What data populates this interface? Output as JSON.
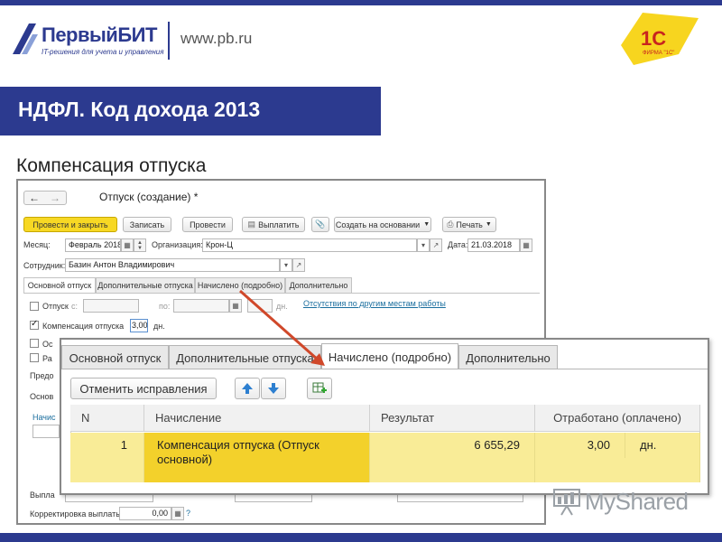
{
  "header": {
    "brand": "ПервыйБИТ",
    "tagline": "IT-решения для учета и управления",
    "website": "www.pb.ru",
    "badge_text": "1С",
    "badge_sub": "ФИРМА \"1С\""
  },
  "slide": {
    "title": "НДФЛ. Код дохода 2013",
    "subtitle": "Компенсация отпуска"
  },
  "window": {
    "title": "Отпуск (создание) *",
    "toolbar": {
      "post_close": "Провести и закрыть",
      "save": "Записать",
      "post": "Провести",
      "pay": "Выплатить",
      "create_base": "Создать на основании",
      "print": "Печать"
    },
    "fields": {
      "month_label": "Месяц:",
      "month_value": "Февраль 2018",
      "org_label": "Организация:",
      "org_value": "Крон-Ц",
      "date_label": "Дата:",
      "date_value": "21.03.2018",
      "employee_label": "Сотрудник:",
      "employee_value": "Базин Антон Владимирович"
    },
    "tabs": [
      "Основной отпуск",
      "Дополнительные отпуска",
      "Начислено (подробно)",
      "Дополнительно"
    ],
    "main": {
      "vacation_label": "Отпуск",
      "from_label": "с:",
      "to_label": "по:",
      "days_suffix": "дн.",
      "absence_link": "Отсутствия по другим местам работы",
      "comp_label": "Компенсация отпуска",
      "comp_value": "3,00",
      "comp_suffix": "дн.",
      "trunc1": "Ос",
      "trunc2": "Ра",
      "trunc3": "Предо",
      "trunc4": "Основ",
      "trunc5": "Начис",
      "trunc6": "Выпла",
      "correction_label": "Корректировка выплаты:",
      "correction_value": "0,00"
    }
  },
  "zoom": {
    "tabs": [
      "Основной отпуск",
      "Дополнительные отпуска",
      "Начислено (подробно)",
      "Дополнительно"
    ],
    "cancel_button": "Отменить исправления",
    "columns": [
      "N",
      "Начисление",
      "Результат",
      "Отработано (оплачено)"
    ],
    "rows": [
      {
        "n": "1",
        "accrual": "Компенсация отпуска (Отпуск основной)",
        "result": "6 655,29",
        "worked": "3,00",
        "unit": "дн."
      }
    ]
  },
  "watermark": "MyShared",
  "colors": {
    "brand": "#2c3a8f",
    "highlight": "#f3d12b",
    "arrow": "#d0482a"
  }
}
